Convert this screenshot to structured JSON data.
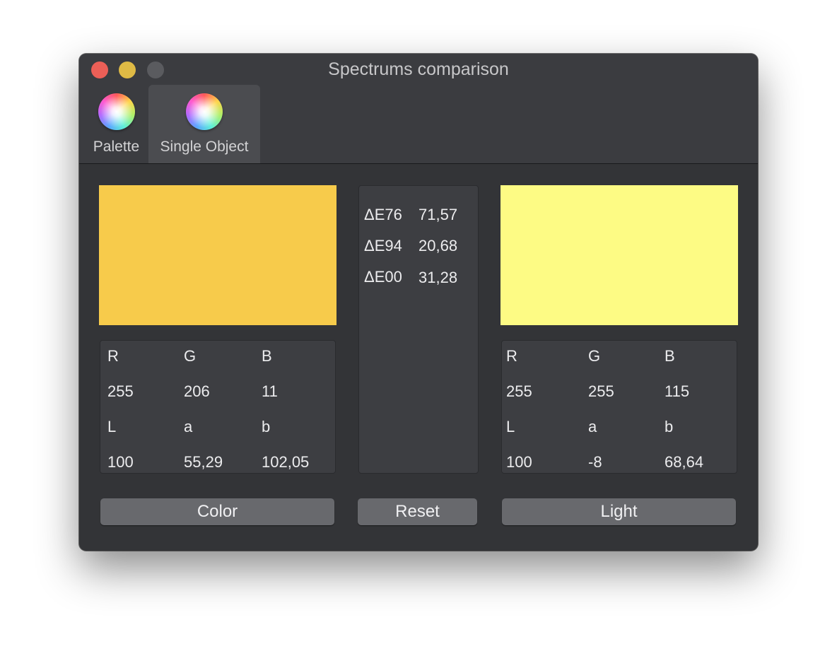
{
  "window": {
    "title": "Spectrums comparison"
  },
  "tabs": [
    {
      "label": "Palette",
      "icon": "color-wheel-icon",
      "selected": false
    },
    {
      "label": "Single Object",
      "icon": "color-wheel-icon",
      "selected": true
    }
  ],
  "color": {
    "swatch_hex": "#f7cb4b",
    "headers_rgb": [
      "R",
      "G",
      "B"
    ],
    "rgb": [
      "255",
      "206",
      "11"
    ],
    "headers_lab": [
      "L",
      "a",
      "b"
    ],
    "lab": [
      "100",
      "55,29",
      "102,05"
    ]
  },
  "light": {
    "swatch_hex": "#fdfb84",
    "headers_rgb": [
      "R",
      "G",
      "B"
    ],
    "rgb": [
      "255",
      "255",
      "115"
    ],
    "headers_lab": [
      "L",
      "a",
      "b"
    ],
    "lab": [
      "100",
      "-8",
      "68,64"
    ]
  },
  "delta": [
    {
      "label": "ΔE76",
      "value": "71,57"
    },
    {
      "label": "ΔE94",
      "value": "20,68"
    },
    {
      "label": "ΔE00",
      "value": "31,28"
    }
  ],
  "buttons": {
    "color": "Color",
    "reset": "Reset",
    "light": "Light"
  }
}
